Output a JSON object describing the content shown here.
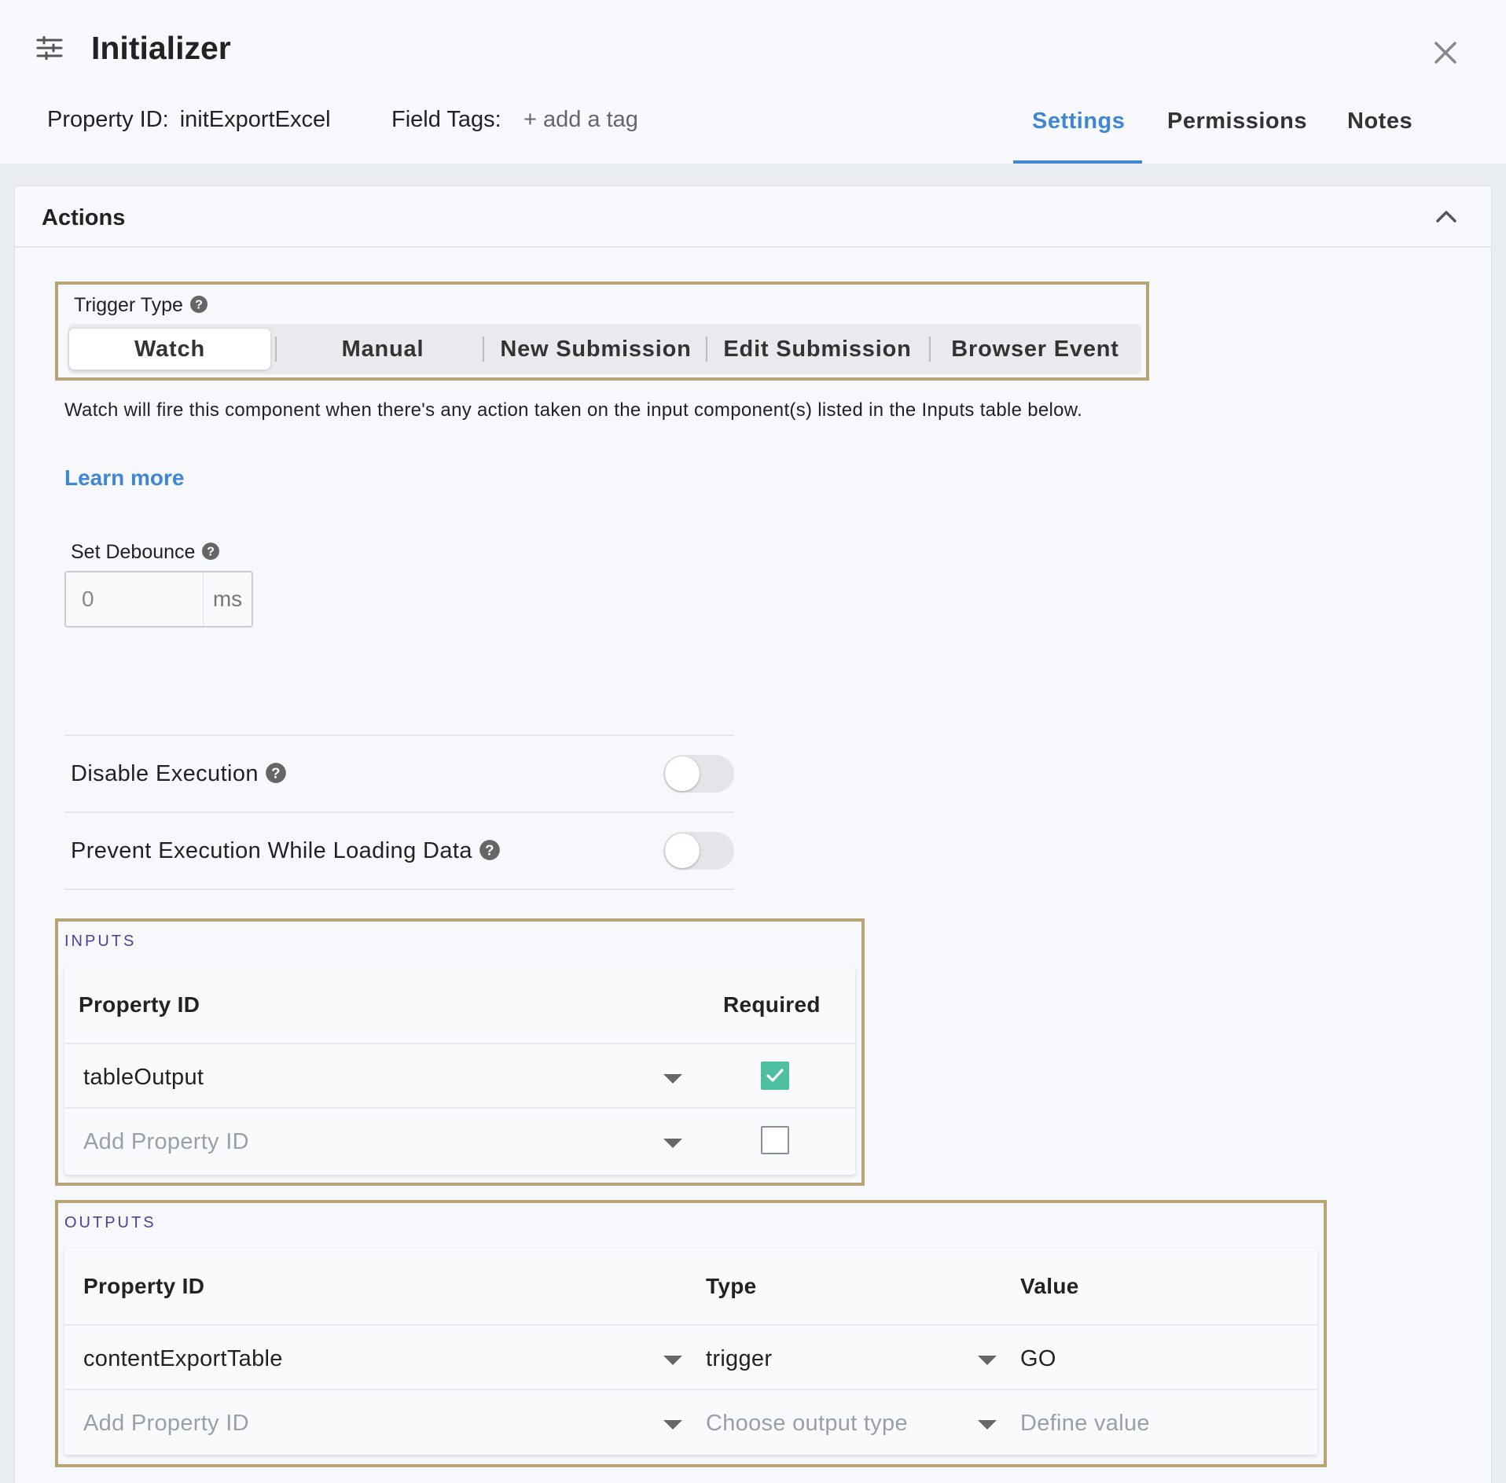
{
  "header": {
    "title": "Initializer",
    "property_id_label": "Property ID:",
    "property_id_value": "initExportExcel",
    "field_tags_label": "Field Tags:",
    "add_tag": "+ add a tag",
    "tabs": [
      {
        "label": "Settings",
        "active": true
      },
      {
        "label": "Permissions",
        "active": false
      },
      {
        "label": "Notes",
        "active": false
      }
    ]
  },
  "actions": {
    "title": "Actions",
    "trigger_type": {
      "label": "Trigger Type",
      "options": [
        "Watch",
        "Manual",
        "New Submission",
        "Edit Submission",
        "Browser Event"
      ],
      "selected": "Watch"
    },
    "description": "Watch will fire this component when there's any action taken on the input component(s) listed in the Inputs table below.",
    "learn_more": "Learn more",
    "debounce": {
      "label": "Set Debounce",
      "value": "0",
      "unit": "ms"
    },
    "toggles": [
      {
        "label": "Disable Execution",
        "on": false
      },
      {
        "label": "Prevent Execution While Loading Data",
        "on": false
      }
    ]
  },
  "inputs": {
    "title": "INPUTS",
    "columns": [
      "Property ID",
      "Required"
    ],
    "rows": [
      {
        "property_id": "tableOutput",
        "required": true
      }
    ],
    "add_placeholder": "Add Property ID"
  },
  "outputs": {
    "title": "OUTPUTS",
    "columns": [
      "Property ID",
      "Type",
      "Value"
    ],
    "rows": [
      {
        "property_id": "contentExportTable",
        "type": "trigger",
        "value": "GO"
      }
    ],
    "placeholders": {
      "property_id": "Add Property ID",
      "type": "Choose output type",
      "value": "Define value"
    }
  },
  "colors": {
    "accent": "#3f86d5",
    "highlight_border": "#b6a474",
    "section_title": "#4b3fa0",
    "checkbox_checked": "#4fbfa2"
  }
}
